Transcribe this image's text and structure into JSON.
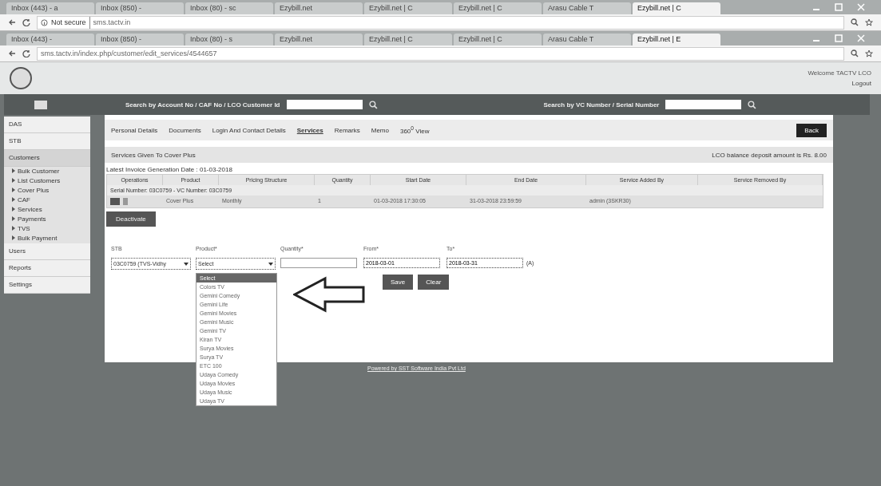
{
  "browser_windows": [
    {
      "tabs": [
        {
          "label": "Inbox (443) - a",
          "selected": false
        },
        {
          "label": "Inbox (850) -",
          "selected": false
        },
        {
          "label": "Inbox (80) - sc",
          "selected": false
        },
        {
          "label": "Ezybill.net",
          "selected": false
        },
        {
          "label": "Ezybill.net | C",
          "selected": false
        },
        {
          "label": "Ezybill.net | C",
          "selected": false
        },
        {
          "label": "Arasu Cable T",
          "selected": false
        },
        {
          "label": "Ezybill.net | C",
          "selected": true
        }
      ],
      "security": "Not secure",
      "url": "sms.tactv.in"
    },
    {
      "tabs": [
        {
          "label": "Inbox (443) -",
          "selected": false
        },
        {
          "label": "Inbox (850) -",
          "selected": false
        },
        {
          "label": "Inbox (80) - s",
          "selected": false
        },
        {
          "label": "Ezybill.net",
          "selected": false
        },
        {
          "label": "Ezybill.net | C",
          "selected": false
        },
        {
          "label": "Ezybill.net | C",
          "selected": false
        },
        {
          "label": "Arasu Cable T",
          "selected": false
        },
        {
          "label": "Ezybill.net | E",
          "selected": true
        }
      ],
      "url": "sms.tactv.in/index.php/customer/edit_services/4544657"
    }
  ],
  "user": {
    "welcome": "Welcome TACTV LCO",
    "logout": "Logout"
  },
  "header": {
    "search_account_label": "Search by Account No / CAF No / LCO Customer Id",
    "search_vc_label": "Search by VC Number / Serial Number"
  },
  "sidebar": {
    "items": [
      {
        "label": "DAS",
        "kind": "main",
        "selected": false
      },
      {
        "label": "STB",
        "kind": "main",
        "selected": false
      },
      {
        "label": "Customers",
        "kind": "main",
        "selected": true
      },
      {
        "label": "Bulk Customer",
        "kind": "sub",
        "selected": false
      },
      {
        "label": "List Customers",
        "kind": "sub",
        "selected": false
      },
      {
        "label": "Cover Plus",
        "kind": "sub",
        "selected": false
      },
      {
        "label": "CAF",
        "kind": "sub",
        "selected": false
      },
      {
        "label": "Services",
        "kind": "sub",
        "selected": false
      },
      {
        "label": "Payments",
        "kind": "sub",
        "selected": false
      },
      {
        "label": "TVS",
        "kind": "sub",
        "selected": false
      },
      {
        "label": "Bulk Payment",
        "kind": "sub",
        "selected": false
      },
      {
        "label": "Users",
        "kind": "main",
        "selected": false
      },
      {
        "label": "Reports",
        "kind": "main",
        "selected": false
      },
      {
        "label": "Settings",
        "kind": "main",
        "selected": false
      }
    ]
  },
  "content_tabs": [
    {
      "label": "Personal Details",
      "selected": false
    },
    {
      "label": "Documents",
      "selected": false
    },
    {
      "label": "Login And Contact Details",
      "selected": false
    },
    {
      "label": "Services",
      "selected": true
    },
    {
      "label": "Remarks",
      "selected": false
    },
    {
      "label": "Memo",
      "selected": false
    },
    {
      "label": "360$^{0}$ View",
      "selected": false
    }
  ],
  "back_button": "Back",
  "section_title": "Services Given To Cover Plus",
  "balance_note": "LCO balance deposit amount is Rs. 8.00",
  "invoice_date": "Latest Invoice Generation Date : 01-03-2018",
  "table": {
    "columns": [
      "Operations",
      "Product",
      "Pricing Structure",
      "Quantity",
      "Start Date",
      "End Date",
      "Service Added By",
      "Service Removed By"
    ],
    "group": "Serial Number: 03C0759 - VC Number: 03C0759",
    "rows": [
      {
        "product": "Cover Plus",
        "pricing": "Monthly",
        "quantity": "1",
        "start": "01-03-2018 17:30:05",
        "end": "31-03-2018 23:59:59",
        "added_by": "admin (3SKR30)",
        "removed_by": ""
      }
    ]
  },
  "deactivate_button": "Deactivate",
  "form": {
    "stb_label": "STB",
    "stb_value": "03C0759 (TVS-Vidhy",
    "product_label": "Product*",
    "product_value": "Select",
    "quantity_label": "Quantity*",
    "from_label": "From*",
    "from_value": "2018-03-01",
    "to_label": "To*",
    "to_value": "2018-03-31",
    "to_suffix": "(A)",
    "product_options": [
      {
        "label": "Select",
        "selected": true
      },
      {
        "label": "Colors TV",
        "selected": false
      },
      {
        "label": "Gemini Comedy",
        "selected": false
      },
      {
        "label": "Gemini Life",
        "selected": false
      },
      {
        "label": "Gemini Movies",
        "selected": false
      },
      {
        "label": "Gemini Music",
        "selected": false
      },
      {
        "label": "Gemini TV",
        "selected": false
      },
      {
        "label": "Kiran TV",
        "selected": false
      },
      {
        "label": "Surya Movies",
        "selected": false
      },
      {
        "label": "Surya TV",
        "selected": false
      },
      {
        "label": "ETC 100",
        "selected": false
      },
      {
        "label": "Udaya Comedy",
        "selected": false
      },
      {
        "label": "Udaya Movies",
        "selected": false
      },
      {
        "label": "Udaya Music",
        "selected": false
      },
      {
        "label": "Udaya TV",
        "selected": false
      }
    ],
    "save_button": "Save",
    "clear_button": "Clear"
  },
  "footer": "Powered by SST Software India Pvt Ltd"
}
